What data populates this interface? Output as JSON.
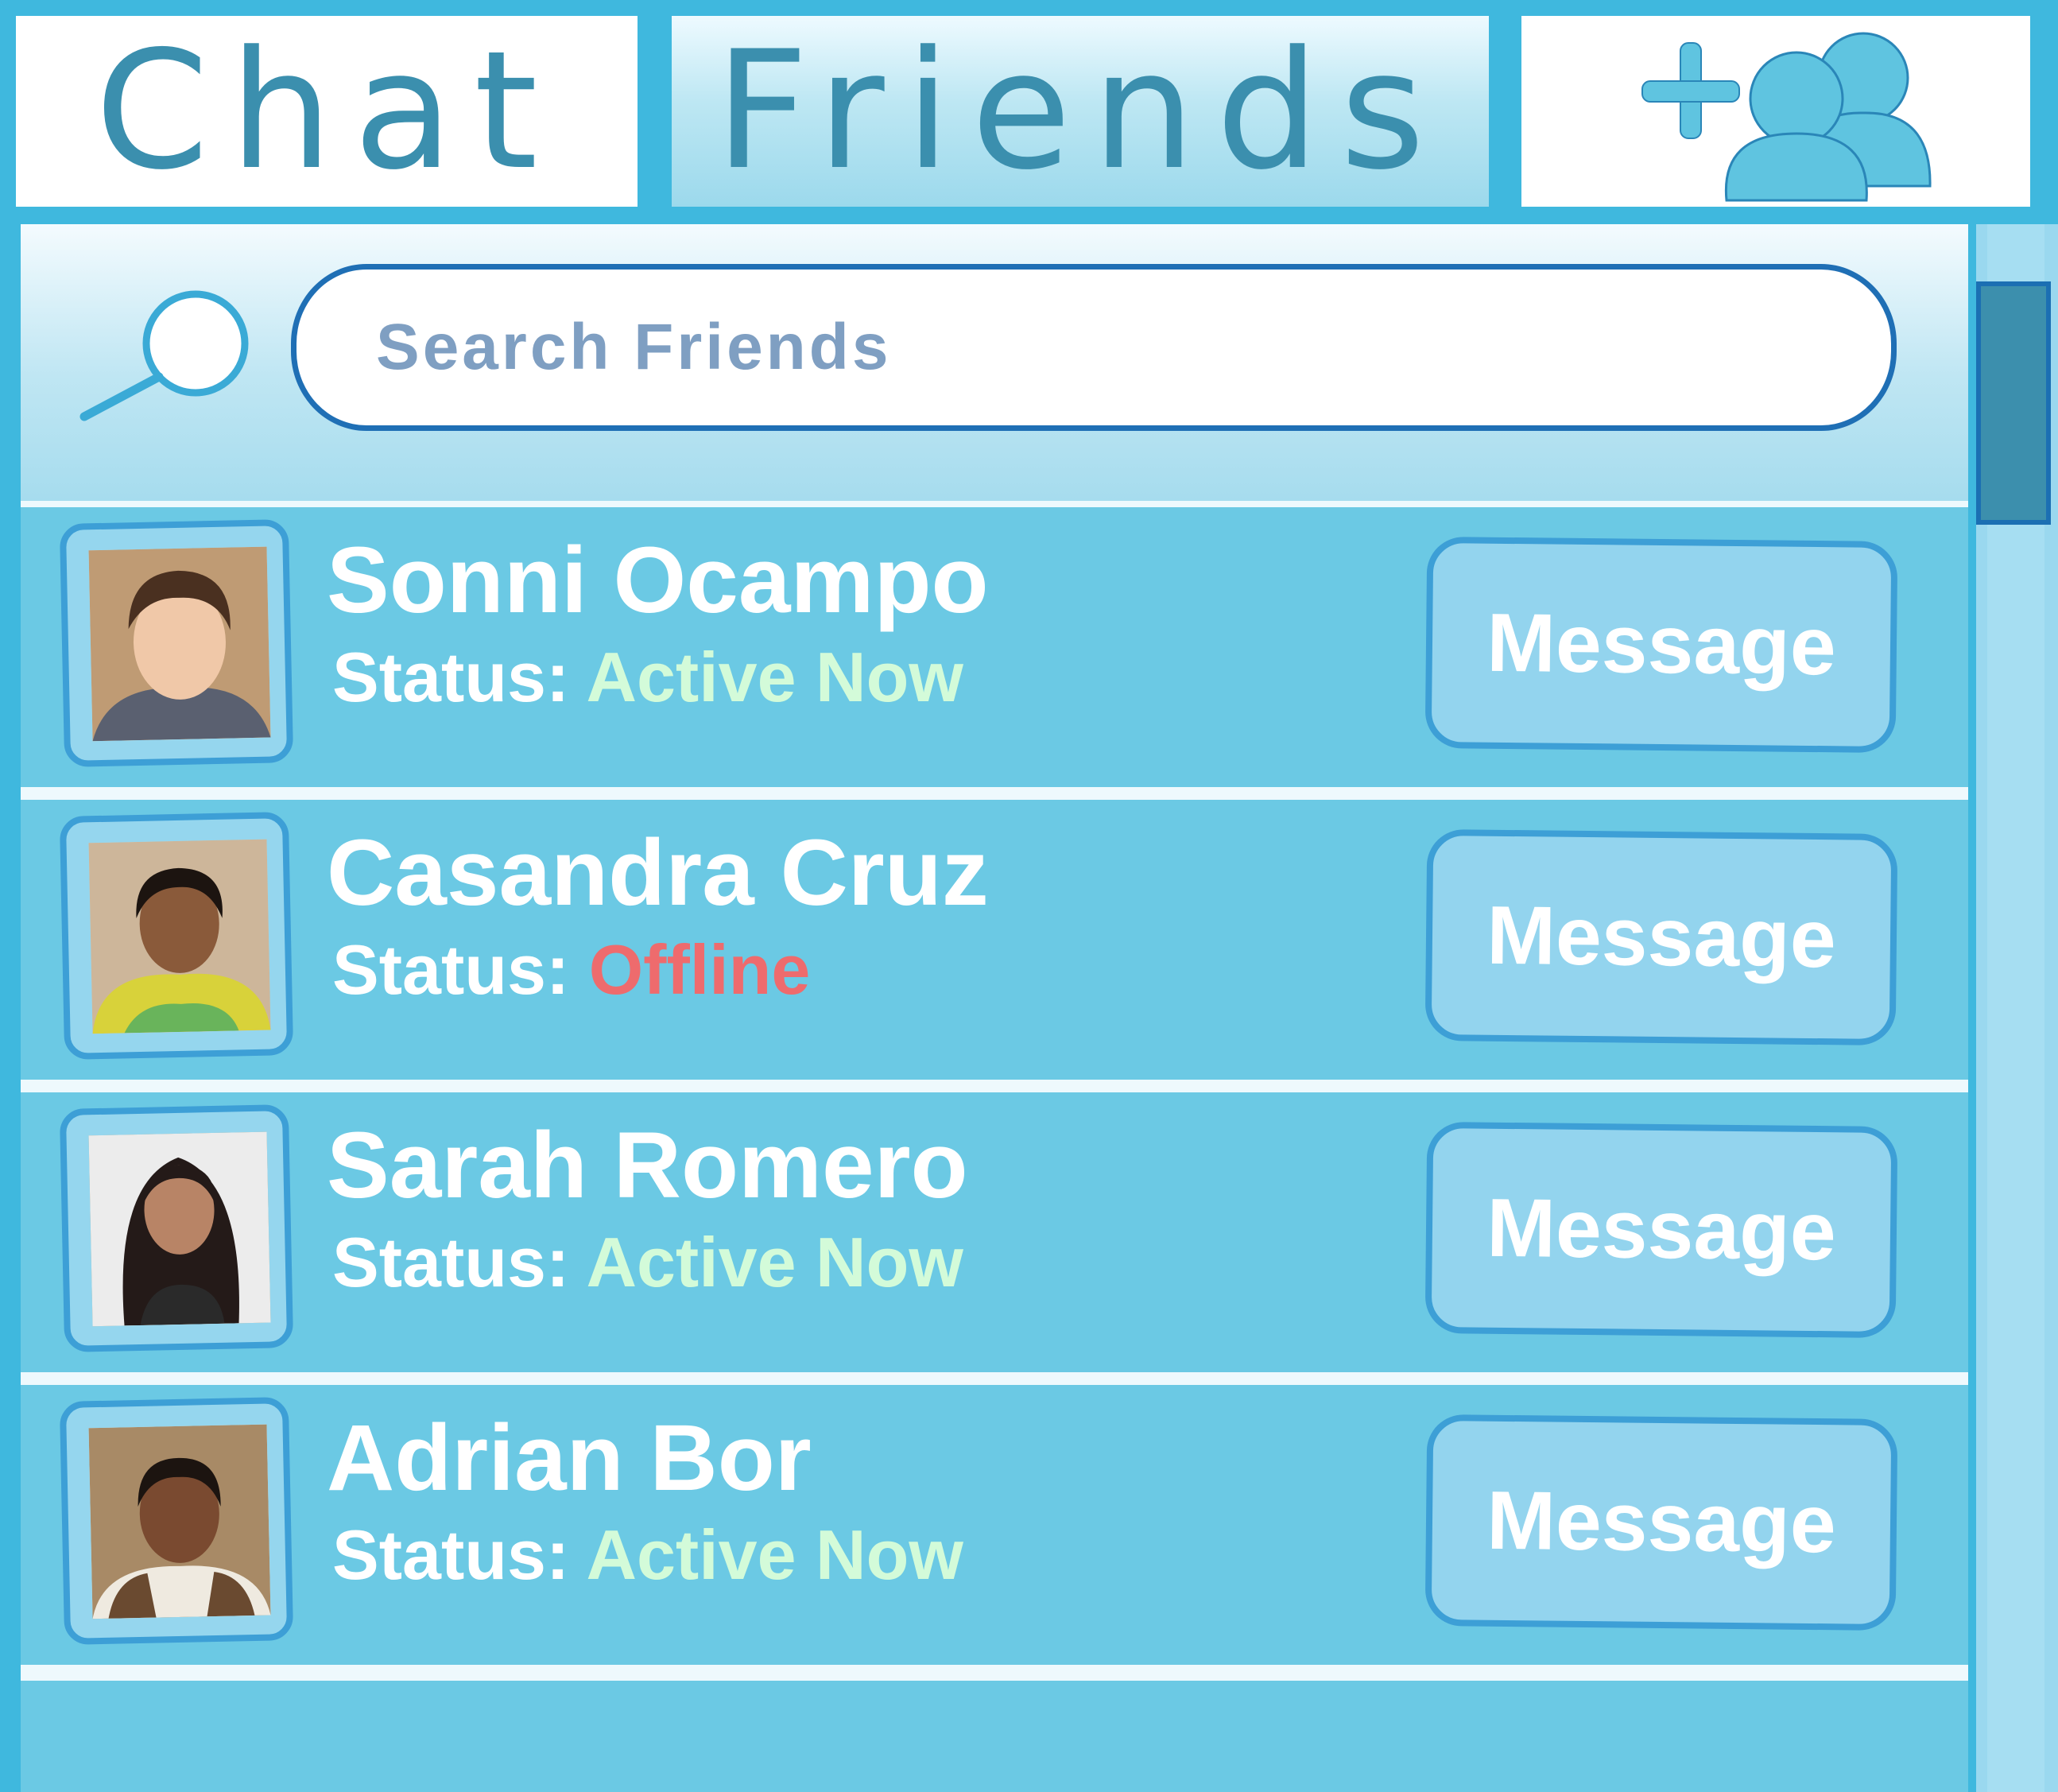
{
  "tabs": {
    "chat_label": "Chat",
    "friends_label": "Friends",
    "add_friend_icon": "add-friend-icon",
    "active_tab": "Friends"
  },
  "search": {
    "placeholder": "Search Friends",
    "icon": "search-icon"
  },
  "friends": [
    {
      "name": "Sonni Ocampo",
      "status_label": "Status:",
      "status": "Active Now",
      "state": "active",
      "button_label": "Message"
    },
    {
      "name": "Casandra Cruz",
      "status_label": "Status:",
      "status": "Offline",
      "state": "offline",
      "button_label": "Message"
    },
    {
      "name": "Sarah Romero",
      "status_label": "Status:",
      "status": "Active Now",
      "state": "active",
      "button_label": "Message"
    },
    {
      "name": "Adrian Bor",
      "status_label": "Status:",
      "status": "Active Now",
      "state": "active",
      "button_label": "Message"
    }
  ],
  "colors": {
    "accent": "#3fb8de",
    "row": "#6bc9e4",
    "tab_text": "#3b8fae",
    "active_status": "#d3fbd9",
    "offline_status": "#ee6b6d",
    "button_border": "#3d9fd6"
  },
  "scrollbar": {
    "position_fraction": 0.0
  }
}
